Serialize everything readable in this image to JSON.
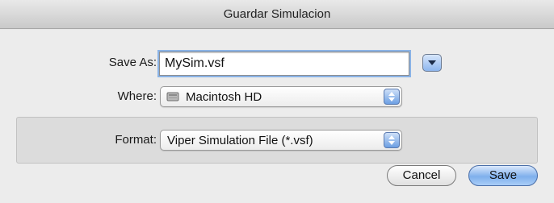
{
  "window": {
    "title": "Guardar Simulacion"
  },
  "save_as": {
    "label": "Save As:",
    "value": "MySim.vsf"
  },
  "where": {
    "label": "Where:",
    "value": "Macintosh HD",
    "icon": "hard-disk-icon"
  },
  "format": {
    "label": "Format:",
    "value": "Viper Simulation File (*.vsf)"
  },
  "buttons": {
    "cancel_label": "Cancel",
    "save_label": "Save"
  },
  "colors": {
    "accent": "#7fb0ec",
    "focus_ring": "#8ab3e6"
  }
}
